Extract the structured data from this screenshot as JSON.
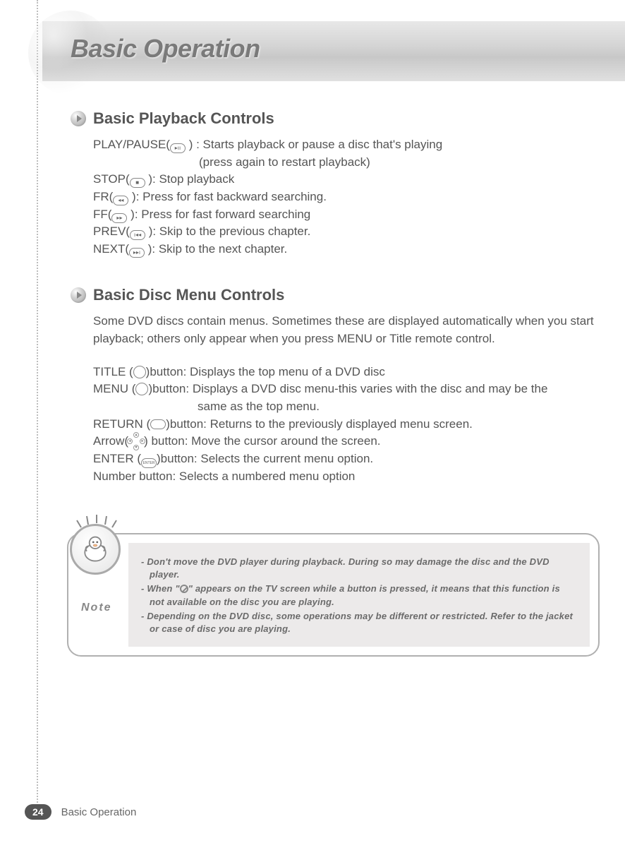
{
  "page_title": "Basic Operation",
  "sections": {
    "playback": {
      "title": "Basic Playback Controls",
      "lines": {
        "play_pause_a": "PLAY/PAUSE(",
        "play_pause_b": " ) :  Starts playback or pause a disc that's playing",
        "play_pause_sub": "(press again to restart playback)",
        "stop_a": "STOP(",
        "stop_b": "  ): Stop playback",
        "fr_a": "FR(",
        "fr_b": " ): Press for fast backward searching.",
        "ff_a": "FF(",
        "ff_b": " ): Press for fast forward searching",
        "prev_a": "PREV(",
        "prev_b": " ): Skip to the previous chapter.",
        "next_a": "NEXT(",
        "next_b": " ): Skip to the next chapter."
      }
    },
    "menu": {
      "title": "Basic Disc Menu Controls",
      "intro": "Some DVD discs contain menus. Sometimes these are displayed automatically when you start playback; others only appear when you press MENU or Title remote control.",
      "lines": {
        "title_a": "TITLE (",
        "title_b": ")button: Displays the top menu of a DVD disc",
        "menu_a": "MENU (",
        "menu_b": ")button: Displays a DVD disc menu-this varies with the disc and may be the",
        "menu_sub": "same as the top menu.",
        "return_a": "RETURN (",
        "return_b": ")button: Returns to the previously displayed menu screen.",
        "arrow_a": "Arrow(",
        "arrow_b": ") button: Move the cursor around the screen.",
        "enter_a": "ENTER (",
        "enter_b": ")button: Selects the current menu option.",
        "number": "Number button: Selects a numbered menu option"
      }
    }
  },
  "note": {
    "label": "Note",
    "items": [
      "- Don't move the DVD player during playback. During so may damage the disc and the DVD player.",
      "- When \"",
      "\" appears on the TV screen while a button is pressed, it means that this function is not available on the disc you are playing.",
      "- Depending on the DVD disc, some operations may be different or restricted. Refer to the jacket or case of disc you are playing."
    ]
  },
  "footer": {
    "page_number": "24",
    "label": "Basic Operation"
  }
}
